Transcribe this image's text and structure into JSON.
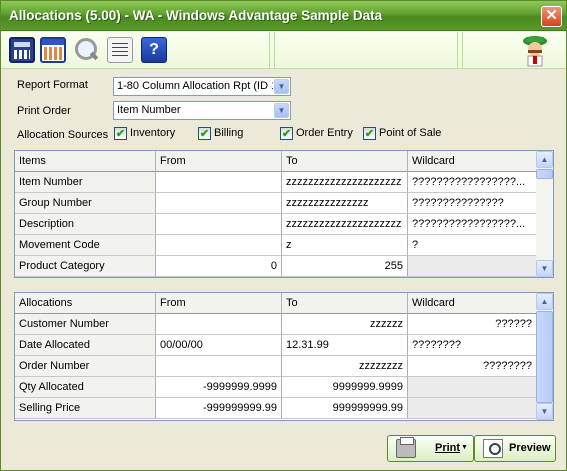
{
  "window": {
    "title": "Allocations (5.00) - WA - Windows Advantage Sample Data",
    "close_glyph": "✕"
  },
  "toolbar": {
    "icons": [
      "calculator-icon",
      "calendar-icon",
      "find-icon",
      "notes-icon",
      "help-icon",
      "mascot-icon"
    ],
    "help_glyph": "?"
  },
  "form": {
    "report_format": {
      "label": "Report Format",
      "value": "1-80 Column Allocation Rpt (ID 1"
    },
    "print_order": {
      "label": "Print Order",
      "value": "Item Number"
    },
    "allocation_sources": {
      "label": "Allocation Sources",
      "options": [
        {
          "label": "Inventory",
          "checked": true
        },
        {
          "label": "Billing",
          "checked": true
        },
        {
          "label": "Order Entry",
          "checked": true
        },
        {
          "label": "Point of Sale",
          "checked": true
        }
      ]
    },
    "check_glyph": "✔"
  },
  "items_grid": {
    "columns": [
      "Items",
      "From",
      "To",
      "Wildcard"
    ],
    "rows": [
      [
        "Item Number",
        "",
        "zzzzzzzzzzzzzzzzzzzzz",
        "?????????????????..."
      ],
      [
        "Group Number",
        "",
        "zzzzzzzzzzzzzzz",
        "???????????????"
      ],
      [
        "Description",
        "",
        "zzzzzzzzzzzzzzzzzzzzz",
        "?????????????????..."
      ],
      [
        "Movement Code",
        "",
        "z",
        "?"
      ],
      [
        "Product Category",
        "0",
        "255",
        ""
      ]
    ]
  },
  "alloc_grid": {
    "columns": [
      "Allocations",
      "From",
      "To",
      "Wildcard"
    ],
    "rows": [
      [
        "Customer Number",
        "",
        "zzzzzz",
        "??????"
      ],
      [
        "Date Allocated",
        "00/00/00",
        "12.31.99",
        "????????"
      ],
      [
        "Order Number",
        "",
        "zzzzzzzz",
        "????????"
      ],
      [
        "Qty Allocated",
        "-9999999.9999",
        "9999999.9999",
        ""
      ],
      [
        "Selling Price",
        "-999999999.99",
        "999999999.99",
        ""
      ]
    ]
  },
  "buttons": {
    "print": "Print",
    "preview": "Preview",
    "dropdown_glyph": "▼"
  },
  "scroll": {
    "up": "▲",
    "down": "▼"
  }
}
